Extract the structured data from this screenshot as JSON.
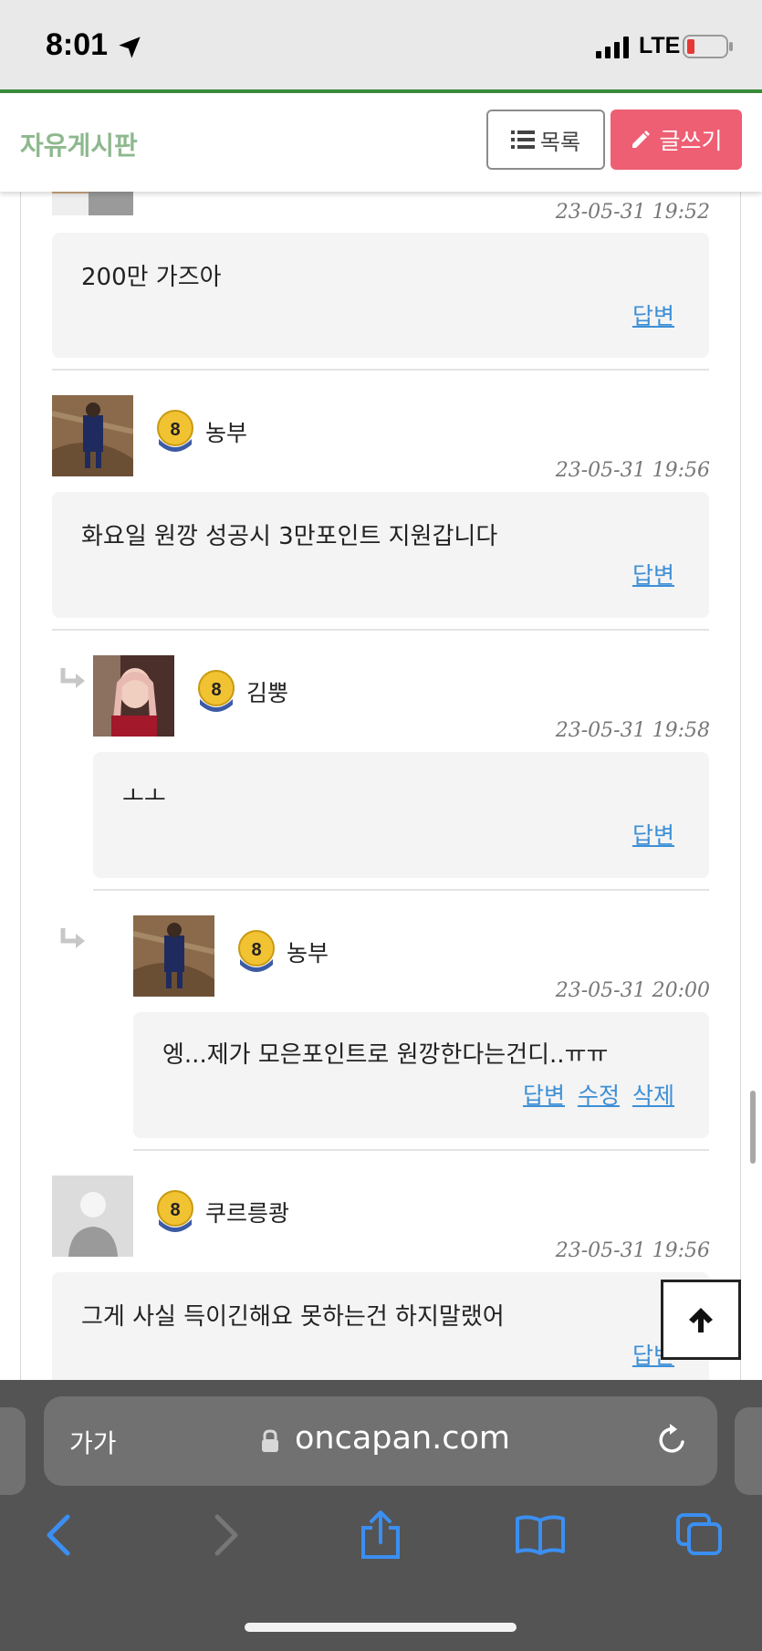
{
  "status_bar": {
    "time": "8:01",
    "network": "LTE"
  },
  "header": {
    "board_title": "자유게시판",
    "list_button": "목록",
    "write_button": "글쓰기"
  },
  "comments": [
    {
      "author": "",
      "timestamp": "23-05-31 19:52",
      "text": "200만 가즈아",
      "actions": [
        "답변"
      ]
    },
    {
      "author": "농부",
      "level": "8",
      "timestamp": "23-05-31 19:56",
      "text": "화요일 원깡 성공시 3만포인트 지원갑니다",
      "actions": [
        "답변"
      ]
    },
    {
      "author": "김뿡",
      "level": "8",
      "timestamp": "23-05-31 19:58",
      "text": "ㅗㅗ",
      "actions": [
        "답변"
      ]
    },
    {
      "author": "농부",
      "level": "8",
      "timestamp": "23-05-31 20:00",
      "text": "엥...제가 모은포인트로 원깡한다는건디..ㅠㅠ",
      "actions": [
        "답변",
        "수정",
        "삭제"
      ]
    },
    {
      "author": "쿠르릉쾅",
      "level": "8",
      "timestamp": "23-05-31 19:56",
      "text": "그게 사실 득이긴해요 못하는건 하지말랬어",
      "actions": [
        "답변"
      ]
    }
  ],
  "browser": {
    "text_size_label": "가가",
    "url": "oncapan.com"
  },
  "colors": {
    "accent_green": "#3a8a3a",
    "write_button": "#ee5f73",
    "link": "#3d8fd6"
  }
}
